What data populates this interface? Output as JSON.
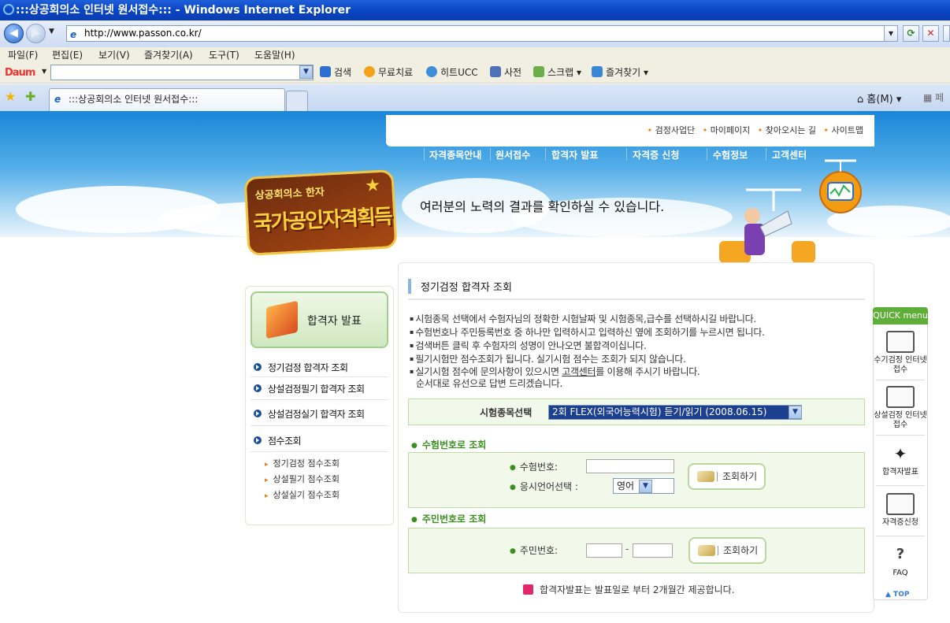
{
  "window": {
    "title": ":::상공회의소 인터넷 원서접수::: - Windows Internet Explorer"
  },
  "address": {
    "url": "http://www.passon.co.kr/"
  },
  "menubar": [
    "파일(F)",
    "편집(E)",
    "보기(V)",
    "즐겨찾기(A)",
    "도구(T)",
    "도움말(H)"
  ],
  "daum_toolbar": {
    "logo": "Daum",
    "search_value": "",
    "items": [
      "검색",
      "무료치료",
      "히트UCC",
      "사전",
      "스크랩",
      "즐겨찾기"
    ]
  },
  "tab": {
    "title": ":::상공회의소 인터넷 원서접수:::",
    "home": "홈(M)",
    "page_partial": "페"
  },
  "site": {
    "util_links": [
      "검정사업단",
      "마이페이지",
      "찾아오시는 길",
      "사이트맵"
    ],
    "gnb": [
      "자격종목안내",
      "원서접수",
      "합격자  발표",
      "자격증 신청",
      "수험정보",
      "고객센터"
    ],
    "logo_line1": "상공회의소 한자",
    "logo_line2": "국가공인자격획득",
    "banner": "여러분의 노력의 결과를 확인하실 수 있습니다."
  },
  "left_menu": {
    "caption": "합격자 발표",
    "items": [
      "정기검정 합격자 조회",
      "상설검정필기 합격자 조회",
      "상설검정실기 합격자 조회",
      "점수조회"
    ],
    "subitems": [
      "정기검정 점수조회",
      "상설필기 점수조회",
      "상설실기 점수조회"
    ]
  },
  "main": {
    "title": "정기검정 합격자 조회",
    "instructions": [
      "시험종목 선택에서 수험자님의 정확한 시험날짜 및 시험종목,급수를 선택하시길 바랍니다.",
      "수험번호나 주민등록번호 중 하나만 입력하시고 입력하신 옆에 조회하기를 누르시면 됩니다.",
      "검색버튼 클릭 후 수험자의 성명이 안나오면 불합격이십니다.",
      "필기시험만 점수조회가 됩니다. 실기시험 점수는 조회가 되지 않습니다."
    ],
    "inst5_a": "실기시험 점수에 문의사항이 있으시면 ",
    "inst5_link": "고객센터",
    "inst5_b": "를 이용해 주시기 바랍니다.",
    "inst6": "순서대로 유선으로 답변 드리겠습니다.",
    "select_label": "시험종목선택",
    "select_value": "2회 FLEX(외국어능력시험) 듣기/읽기 (2008.06.15)",
    "section1": "수험번호로 조회",
    "exam_no_label": "수험번호:",
    "exam_no_value": "",
    "lang_label": "응시언어선택 :",
    "lang_value": "영어",
    "section2": "주민번호로 조회",
    "rrn_label": "주민번호:",
    "rrn_front": "",
    "rrn_back": "",
    "dash": "-",
    "query_button": "조회하기",
    "notice": "합격자발표는 발표일로 부터 2개월간 제공합니다."
  },
  "quick_menu": {
    "head": "QUICK menu",
    "items": [
      "수기검정 인터넷접수",
      "상설검정 인터넷접수",
      "합격자발표",
      "자격증신청",
      "FAQ"
    ],
    "top": "▲ TOP"
  }
}
